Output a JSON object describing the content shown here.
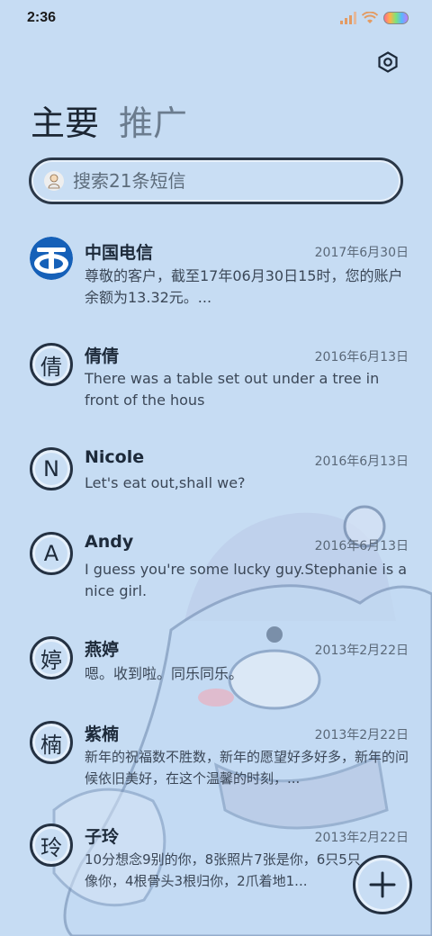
{
  "status": {
    "time": "2:36"
  },
  "tabs": [
    {
      "label": "主要"
    },
    {
      "label": "推广"
    }
  ],
  "search": {
    "placeholder": "搜索21条短信"
  },
  "conversations": [
    {
      "avatar": "",
      "name": "中国电信",
      "date": "2017年6月30日",
      "preview": "尊敬的客户，截至17年06月30日15时，您的账户余额为13.32元。..."
    },
    {
      "avatar": "倩",
      "name": "倩倩",
      "date": "2016年6月13日",
      "preview": "There was a table set out under a tree in front of the hous"
    },
    {
      "avatar": "N",
      "name": "Nicole",
      "date": "2016年6月13日",
      "preview": "Let's eat out,shall we?"
    },
    {
      "avatar": "A",
      "name": "Andy",
      "date": "2016年6月13日",
      "preview": "I guess you're some lucky guy.Stephanie is a nice girl."
    },
    {
      "avatar": "婷",
      "name": "燕婷",
      "date": "2013年2月22日",
      "preview": "嗯。收到啦。同乐同乐。"
    },
    {
      "avatar": "楠",
      "name": "紫楠",
      "date": "2013年2月22日",
      "preview": "新年的祝福数不胜数，新年的愿望好多好多，新年的问候依旧美好，在这个温馨的时刻，..."
    },
    {
      "avatar": "玲",
      "name": "子玲",
      "date": "2013年2月22日",
      "preview": "10分想念9别的你，8张照片7张是你，6只5只像你，4根骨头3根归你，2爪着地1..."
    }
  ],
  "colors": {
    "background": "#c6dcf3",
    "accent": "#243142",
    "telecom_blue": "#1560b8"
  },
  "icons": {
    "settings": "settings-hex-icon",
    "compose": "plus-icon"
  }
}
